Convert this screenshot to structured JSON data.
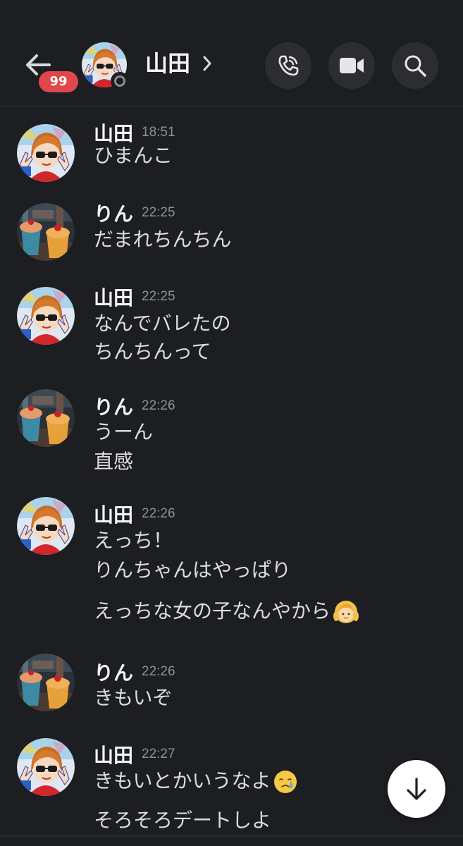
{
  "header": {
    "unread_badge": "99",
    "contact_name": "山田",
    "actions": [
      "phone-icon",
      "video-camera-icon",
      "search-icon"
    ]
  },
  "messages": [
    {
      "author": "山田",
      "time": "18:51",
      "lines": [
        "ひまんこ"
      ],
      "avatar": "yamada-avatar"
    },
    {
      "author": "りん",
      "time": "22:25",
      "lines": [
        "だまれちんちん"
      ],
      "avatar": "rin-avatar"
    },
    {
      "author": "山田",
      "time": "22:25",
      "lines": [
        "なんでバレたの",
        "ちんちんって"
      ],
      "avatar": "yamada-avatar"
    },
    {
      "author": "りん",
      "time": "22:26",
      "lines": [
        "うーん",
        "直感"
      ],
      "avatar": "rin-avatar"
    },
    {
      "author": "山田",
      "time": "22:26",
      "lines": [
        "えっち！",
        "りんちゃんはやっぱり",
        "えっちな女の子なんやから"
      ],
      "avatar": "yamada-avatar"
    },
    {
      "author": "りん",
      "time": "22:26",
      "lines": [
        "きもいぞ"
      ],
      "avatar": "rin-avatar"
    },
    {
      "author": "山田",
      "time": "22:27",
      "lines": [
        "きもいとかいうなよ",
        "そろそろデートしよ"
      ],
      "avatar": "yamada-avatar"
    }
  ],
  "emoji": {
    "girl": "girl-emoji",
    "crying": "crying-face-emoji"
  },
  "colors": {
    "background": "#1d1e22",
    "badge": "#e0474c",
    "button_bg": "#2b2d31",
    "timestamp": "#8d9098"
  }
}
